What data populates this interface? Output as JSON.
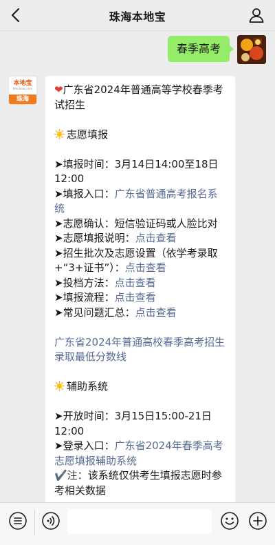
{
  "header": {
    "title": "珠海本地宝"
  },
  "outgoing": {
    "text": "春季高考"
  },
  "bot": {
    "avatar_logo": "本地宝",
    "avatar_domain": "Bendibao.com",
    "avatar_city": "珠海"
  },
  "message": {
    "title": "广东省2024年普通高等学校春季考试招生",
    "section1_heading": "志愿填报",
    "apply_time_label": "➤填报时间：",
    "apply_time_value": "3月14日14:00至18日12:00",
    "entry_label": "➤填报入口：",
    "entry_link": "广东省普通高考报名系统",
    "confirm_label": "➤志愿确认：",
    "confirm_value": "短信验证码或人脸比对",
    "guide_label": "➤志愿填报说明：",
    "guide_link": "点击查看",
    "batches_label": "➤招生批次及志愿设置（依学考录取+“3+证书”）：",
    "batches_link": "点击查看",
    "method_label": "➤投档方法：",
    "method_link": "点击查看",
    "process_label": "➤填报流程：",
    "process_link": "点击查看",
    "faq_label": "➤常见问题汇总：",
    "faq_link": "点击查看",
    "min_score_link": "广东省2024年普通高校春季高考招生录取最低分数线",
    "section2_heading": "辅助系统",
    "open_time_label": "➤开放时间：",
    "open_time_value": "3月15日15:00-21日12:00",
    "login_label": "➤登录入口：",
    "login_link": "广东省2024年春季高考志愿填报辅助系统",
    "note_label": "✔️注：",
    "note_value": "该系统仅供考生填报志愿时参考相关数据"
  },
  "input": {
    "placeholder": ""
  },
  "colors": {
    "background": "#ededed",
    "outgoing_bubble": "#95ec69",
    "incoming_bubble": "#ffffff",
    "link": "#576b95",
    "brand_orange": "#f07a1e"
  },
  "icons": [
    "back-arrow-icon",
    "person-icon",
    "heart-icon",
    "sun-icon",
    "menu-list-icon",
    "voice-icon",
    "emoji-icon",
    "plus-icon"
  ]
}
